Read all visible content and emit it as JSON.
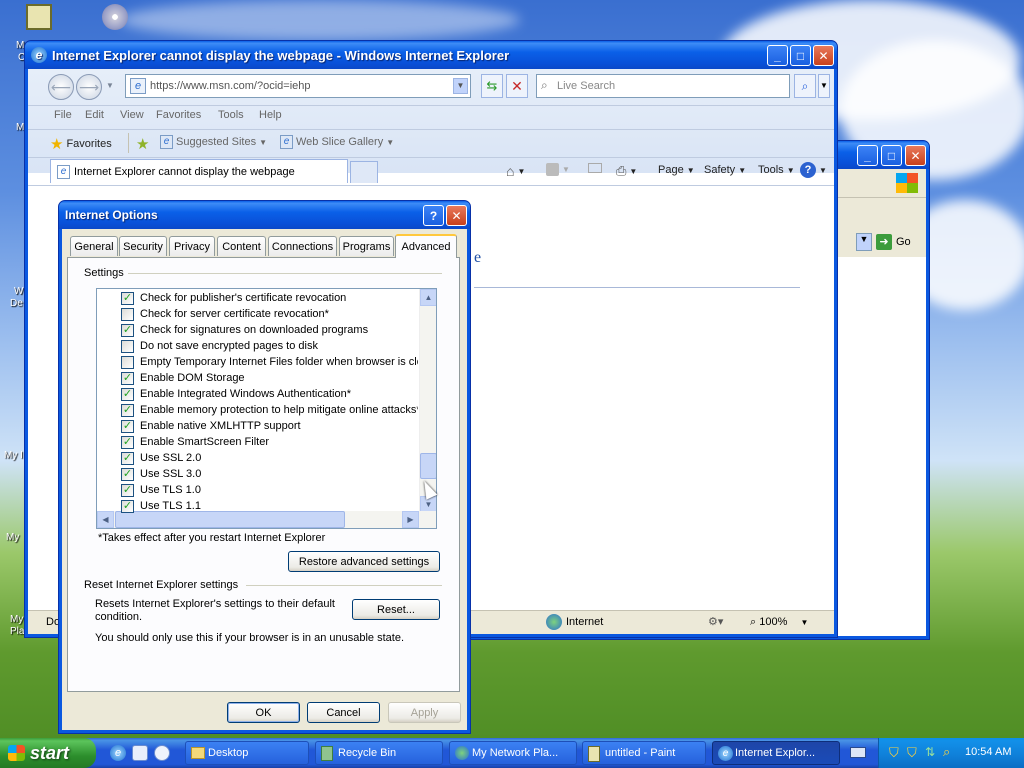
{
  "ie": {
    "title": "Internet Explorer cannot display the webpage - Windows Internet Explorer",
    "address": "https://www.msn.com/?ocid=iehp",
    "search_placeholder": "Live Search",
    "menu": [
      "File",
      "Edit",
      "View",
      "Favorites",
      "Tools",
      "Help"
    ],
    "favorites_label": "Favorites",
    "suggested_sites": "Suggested Sites",
    "web_slice": "Web Slice Gallery",
    "tab_title": "Internet Explorer cannot display the webpage",
    "cmd_page": "Page",
    "cmd_safety": "Safety",
    "cmd_tools": "Tools",
    "status_left": "Dor",
    "status_zone": "Internet",
    "zoom": "100%",
    "go_label": "Go"
  },
  "dialog": {
    "title": "Internet Options",
    "tabs": [
      "General",
      "Security",
      "Privacy",
      "Content",
      "Connections",
      "Programs",
      "Advanced"
    ],
    "settings_label": "Settings",
    "settings": [
      {
        "label": "Check for publisher's certificate revocation",
        "checked": true
      },
      {
        "label": "Check for server certificate revocation*",
        "checked": false
      },
      {
        "label": "Check for signatures on downloaded programs",
        "checked": true
      },
      {
        "label": "Do not save encrypted pages to disk",
        "checked": false
      },
      {
        "label": "Empty Temporary Internet Files folder when browser is clo",
        "checked": false
      },
      {
        "label": "Enable DOM Storage",
        "checked": true
      },
      {
        "label": "Enable Integrated Windows Authentication*",
        "checked": true
      },
      {
        "label": "Enable memory protection to help mitigate online attacks*",
        "checked": true
      },
      {
        "label": "Enable native XMLHTTP support",
        "checked": true
      },
      {
        "label": "Enable SmartScreen Filter",
        "checked": true
      },
      {
        "label": "Use SSL 2.0",
        "checked": true
      },
      {
        "label": "Use SSL 3.0",
        "checked": true
      },
      {
        "label": "Use TLS 1.0",
        "checked": true
      },
      {
        "label": "Use TLS 1.1",
        "checked": true
      }
    ],
    "restart_note": "*Takes effect after you restart Internet Explorer",
    "restore_btn": "Restore advanced settings",
    "reset_group": "Reset Internet Explorer settings",
    "reset_desc": "Resets Internet Explorer's settings to their default condition.",
    "reset_btn": "Reset...",
    "reset_warn": "You should only use this if your browser is in an unusable state.",
    "ok": "OK",
    "cancel": "Cancel",
    "apply": "Apply"
  },
  "taskbar": {
    "start": "start",
    "tasks": [
      "Desktop",
      "Recycle Bin",
      "My Network Pla...",
      "untitled - Paint",
      "Internet Explor..."
    ],
    "time": "10:54 AM"
  },
  "desktop_labels": [
    "M",
    "C",
    "A",
    "M",
    "W",
    "De",
    "My I",
    "My",
    "My",
    "Pla"
  ]
}
